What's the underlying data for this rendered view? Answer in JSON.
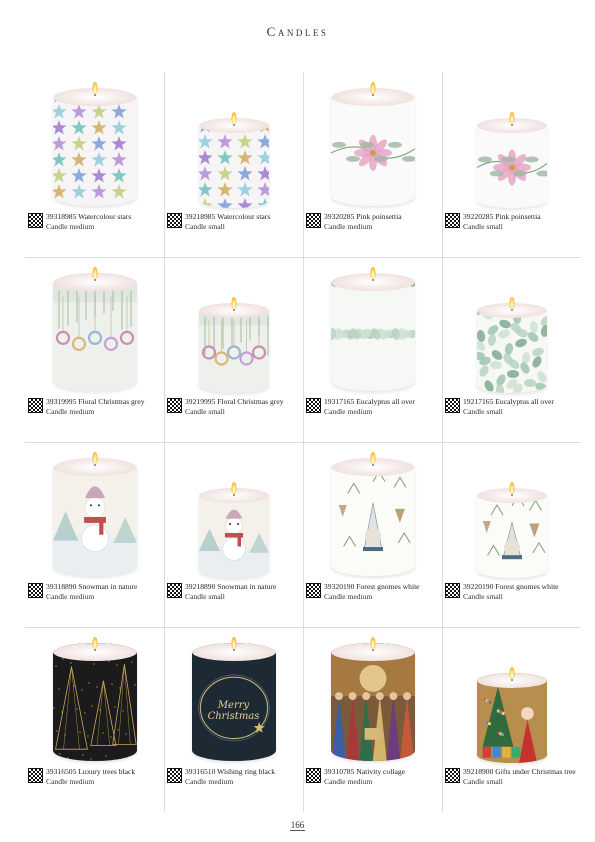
{
  "header": {
    "title": "Candles"
  },
  "products": [
    {
      "code_name": "39318985 Watercolour stars",
      "size": "Candle medium",
      "theme": "stars",
      "scale": "medium"
    },
    {
      "code_name": "39218985 Watercolour stars",
      "size": "Candle small",
      "theme": "stars",
      "scale": "small"
    },
    {
      "code_name": "39320285 Pink poinsettia",
      "size": "Candle medium",
      "theme": "poinsettia",
      "scale": "medium"
    },
    {
      "code_name": "39220285 Pink poinsettia",
      "size": "Candle small",
      "theme": "poinsettia",
      "scale": "small"
    },
    {
      "code_name": "39319995 Floral Christmas grey",
      "size": "Candle medium",
      "theme": "floral-grey",
      "scale": "medium"
    },
    {
      "code_name": "39219995 Floral Christmas grey",
      "size": "Candle small",
      "theme": "floral-grey",
      "scale": "small"
    },
    {
      "code_name": "19317165 Eucalyptus all over",
      "size": "Candle medium",
      "theme": "eucalyptus",
      "scale": "medium"
    },
    {
      "code_name": "19217165 Eucalyptus all over",
      "size": "Candle small",
      "theme": "eucalyptus",
      "scale": "small"
    },
    {
      "code_name": "39318890 Snowman in nature",
      "size": "Candle medium",
      "theme": "snowman",
      "scale": "medium"
    },
    {
      "code_name": "39218890 Snowman in nature",
      "size": "Candle small",
      "theme": "snowman",
      "scale": "small"
    },
    {
      "code_name": "39320190 Forest gnomes white",
      "size": "Candle medium",
      "theme": "gnomes",
      "scale": "medium"
    },
    {
      "code_name": "39220190 Forest gnomes white",
      "size": "Candle small",
      "theme": "gnomes",
      "scale": "small"
    },
    {
      "code_name": "39316505 Luxury trees black",
      "size": "Candle medium",
      "theme": "luxury-trees",
      "scale": "medium"
    },
    {
      "code_name": "39316510 Wishing ring black",
      "size": "Candle medium",
      "theme": "wishing-ring",
      "scale": "medium",
      "candle_text": "Merry Christmas"
    },
    {
      "code_name": "39310785 Nativity collage",
      "size": "Candle medium",
      "theme": "nativity",
      "scale": "medium"
    },
    {
      "code_name": "39218900 Gifts under Christmas tree",
      "size": "Candle small",
      "theme": "gifts-tree",
      "scale": "small"
    }
  ],
  "footer": {
    "page_number": "166"
  }
}
